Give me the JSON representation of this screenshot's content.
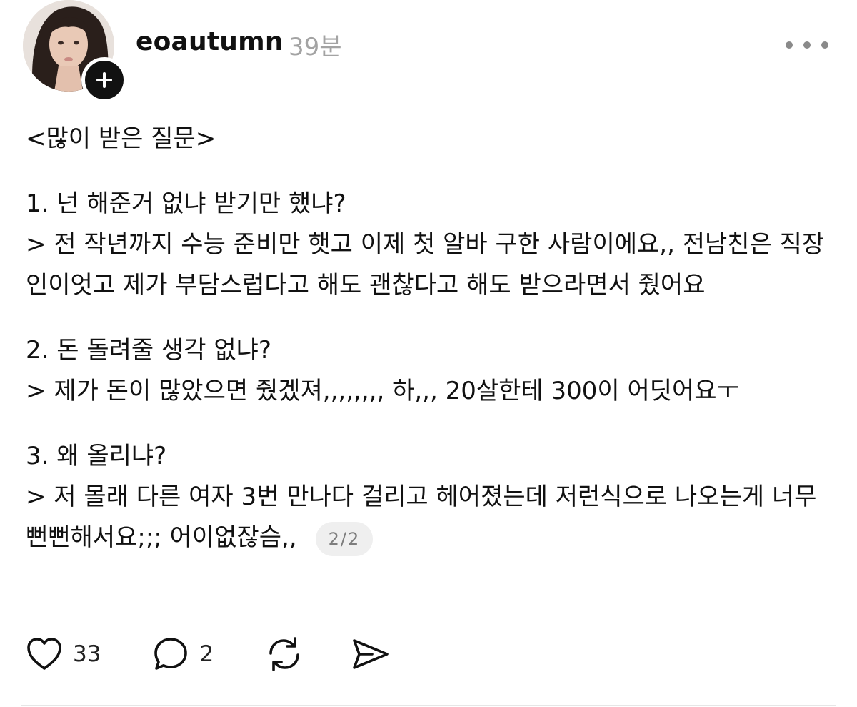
{
  "post": {
    "author": {
      "username": "eoautumn",
      "timestamp": "39분"
    },
    "body": {
      "heading": "<많이 받은 질문>",
      "q1": "1. 넌 해준거 없냐 받기만 했냐?",
      "a1": "> 전 작년까지 수능 준비만 햇고 이제 첫 알바 구한 사람이에요,, 전남친은 직장인이엇고 제가 부담스럽다고 해도 괜찮다고 해도 받으라면서 줬어요",
      "q2": "2. 돈 돌려줄 생각 없냐?",
      "a2": "> 제가 돈이 많았으면 줬겠져,,,,,,,, 하,,, 20살한테 300이 어딧어요ㅜ",
      "q3": "3. 왜 올리냐?",
      "a3": "> 저 몰래 다른 여자 3번 만나다 걸리고 헤어졌는데 저런식으로 나오는게 너무 뻔뻔해서요;;; 어이없잖슴,,",
      "page_indicator": "2/2"
    },
    "actions": {
      "like_count": "33",
      "comment_count": "2",
      "like_icon": "heart-icon",
      "comment_icon": "speech-bubble-icon",
      "repost_icon": "repost-icon",
      "share_icon": "send-icon"
    }
  }
}
